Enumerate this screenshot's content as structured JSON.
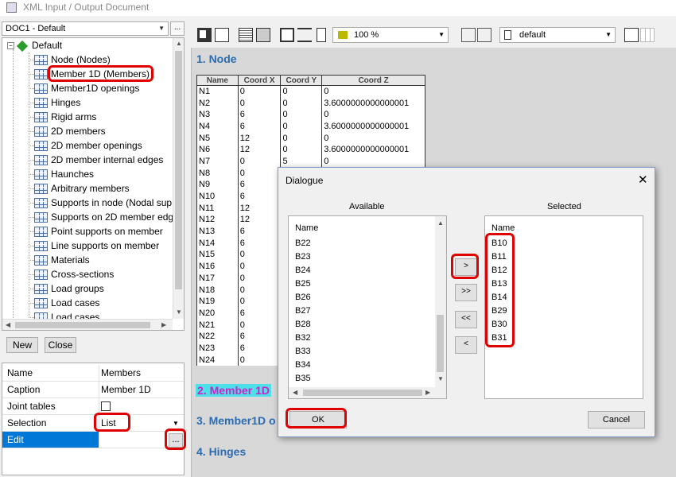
{
  "window": {
    "title": "XML Input / Output Document"
  },
  "left": {
    "doc_select": "DOC1 - Default",
    "doc_btn": "...",
    "tree_root": "Default",
    "tree_items": [
      "Node (Nodes)",
      "Member 1D (Members)",
      "Member1D openings",
      "Hinges",
      "Rigid arms",
      "2D members",
      "2D member openings",
      "2D member internal edges",
      "Haunches",
      "Arbitrary members",
      "Supports in node (Nodal sup",
      "Supports on 2D member edg",
      "Point supports on member",
      "Line supports on member",
      "Materials",
      "Cross-sections",
      "Load groups",
      "Load cases",
      "Load cases"
    ],
    "new_btn": "New",
    "close_btn": "Close"
  },
  "props": {
    "rows": [
      {
        "key": "Name",
        "value": "Members"
      },
      {
        "key": "Caption",
        "value": "Member 1D"
      },
      {
        "key": "Joint tables",
        "value": ""
      },
      {
        "key": "Selection",
        "value": "List"
      },
      {
        "key": "Edit",
        "value": ""
      }
    ],
    "edit_btn": "..."
  },
  "toolbar": {
    "zoom": "100 %",
    "style": "default",
    "zoom_color": "#b8b800"
  },
  "document": {
    "section1": "1. Node",
    "section2": "2. Member 1D",
    "section3": "3. Member1D o",
    "section4": "4. Hinges",
    "table_headers": [
      "Name",
      "Coord X",
      "Coord Y",
      "Coord Z"
    ],
    "rows": [
      [
        "N1",
        "0",
        "0",
        "0"
      ],
      [
        "N2",
        "0",
        "0",
        "3.6000000000000001"
      ],
      [
        "N3",
        "6",
        "0",
        "0"
      ],
      [
        "N4",
        "6",
        "0",
        "3.6000000000000001"
      ],
      [
        "N5",
        "12",
        "0",
        "0"
      ],
      [
        "N6",
        "12",
        "0",
        "3.6000000000000001"
      ],
      [
        "N7",
        "0",
        "5",
        "0"
      ],
      [
        "N8",
        "0",
        "",
        ""
      ],
      [
        "N9",
        "6",
        "",
        ""
      ],
      [
        "N10",
        "6",
        "",
        ""
      ],
      [
        "N11",
        "12",
        "",
        ""
      ],
      [
        "N12",
        "12",
        "",
        ""
      ],
      [
        "N13",
        "6",
        "",
        ""
      ],
      [
        "N14",
        "6",
        "",
        ""
      ],
      [
        "N15",
        "0",
        "",
        ""
      ],
      [
        "N16",
        "0",
        "",
        ""
      ],
      [
        "N17",
        "0",
        "",
        ""
      ],
      [
        "N18",
        "0",
        "",
        ""
      ],
      [
        "N19",
        "0",
        "",
        ""
      ],
      [
        "N20",
        "6",
        "",
        ""
      ],
      [
        "N21",
        "0",
        "",
        ""
      ],
      [
        "N22",
        "6",
        "",
        ""
      ],
      [
        "N23",
        "6",
        "",
        ""
      ],
      [
        "N24",
        "0",
        "",
        ""
      ]
    ]
  },
  "dialog": {
    "title": "Dialogue",
    "close": "✕",
    "available_label": "Available",
    "selected_label": "Selected",
    "available_header": "Name",
    "selected_header": "Name",
    "available_items": [
      "B22",
      "B23",
      "B24",
      "B25",
      "B26",
      "B27",
      "B28",
      "B32",
      "B33",
      "B34",
      "B35"
    ],
    "selected_items": [
      "B10",
      "B11",
      "B12",
      "B13",
      "B14",
      "B29",
      "B30",
      "B31"
    ],
    "btn_add": ">",
    "btn_add_all": ">>",
    "btn_remove_all": "<<",
    "btn_remove": "<",
    "ok": "OK",
    "cancel": "Cancel"
  },
  "colors": {
    "accent_red": "#e00000",
    "heading_blue": "#2b6cb0",
    "highlight_cyan": "#4ee0e8",
    "highlight_magenta": "#d020c8"
  }
}
